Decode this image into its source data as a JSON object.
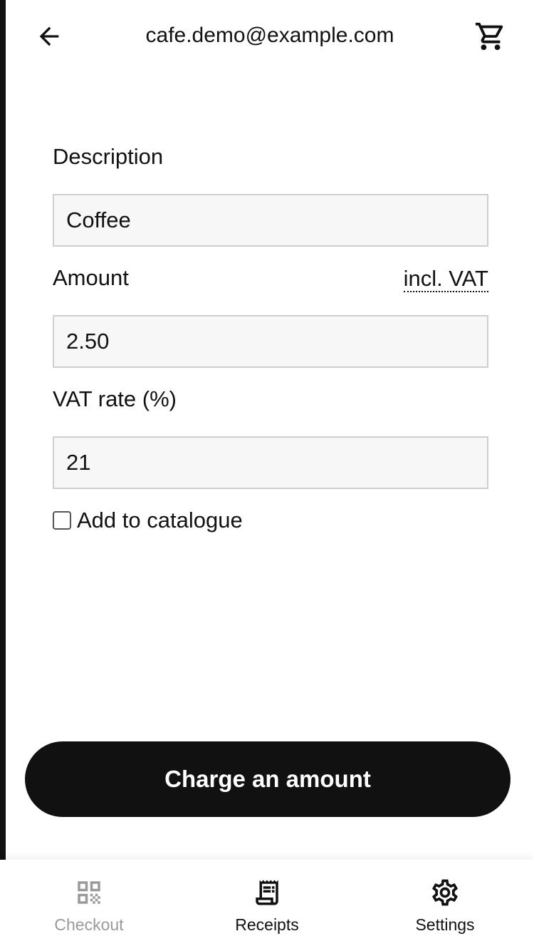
{
  "header": {
    "account_email": "cafe.demo@example.com",
    "back_icon": "arrow-left-icon",
    "cart_icon": "shopping-cart-icon"
  },
  "form": {
    "description_label": "Description",
    "description_value": "Coffee",
    "amount_label": "Amount",
    "vat_toggle_label": "incl. VAT",
    "amount_value": "2.50",
    "vat_rate_label": "VAT rate (%)",
    "vat_rate_value": "21",
    "catalogue_checkbox_label": "Add to catalogue",
    "catalogue_checked": false
  },
  "charge_button_label": "Charge an amount",
  "bottom_nav": {
    "items": [
      {
        "label": "Checkout",
        "icon": "qr-code-icon",
        "state": "disabled"
      },
      {
        "label": "Receipts",
        "icon": "receipt-icon",
        "state": "normal"
      },
      {
        "label": "Settings",
        "icon": "gear-icon",
        "state": "normal"
      }
    ]
  },
  "colors": {
    "primary": "#111111",
    "field_background": "#f7f7f7",
    "field_border": "#cfcfcf",
    "disabled_text": "#9a9a9a"
  }
}
